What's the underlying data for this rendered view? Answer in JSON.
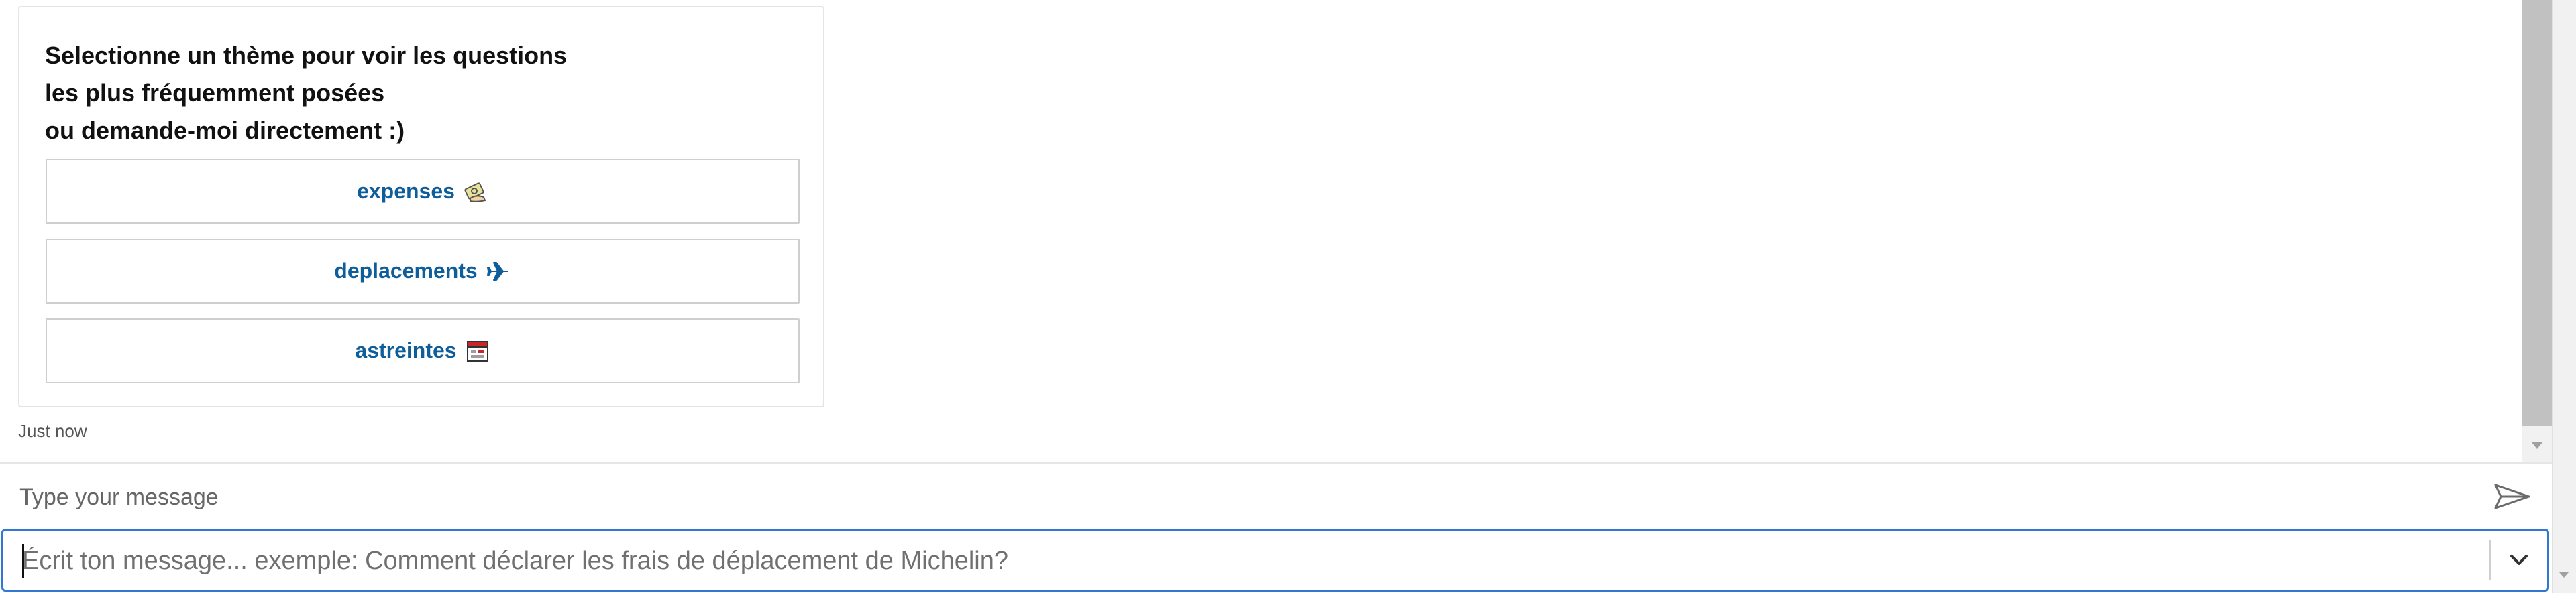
{
  "card": {
    "title_lines": [
      "Selectionne un thème pour voir les questions",
      "les plus fréquemment posées",
      "ou demande-moi directement :)"
    ],
    "buttons": [
      {
        "label": "expenses",
        "icon": "money-hand-icon"
      },
      {
        "label": "deplacements",
        "icon": "airplane-icon"
      },
      {
        "label": "astreintes",
        "icon": "calendar-icon"
      }
    ]
  },
  "message": {
    "timestamp": "Just now"
  },
  "composer": {
    "placeholder": "Type your message",
    "send_icon": "send-icon"
  },
  "combo": {
    "placeholder": "Écrit ton message... exemple: Comment déclarer les frais de déplacement de Michelin?",
    "chevron_icon": "chevron-down-icon"
  },
  "colors": {
    "accent": "#2f78d4",
    "button_text": "#0f5e9c",
    "scroll_thumb": "#c1c1c1"
  }
}
